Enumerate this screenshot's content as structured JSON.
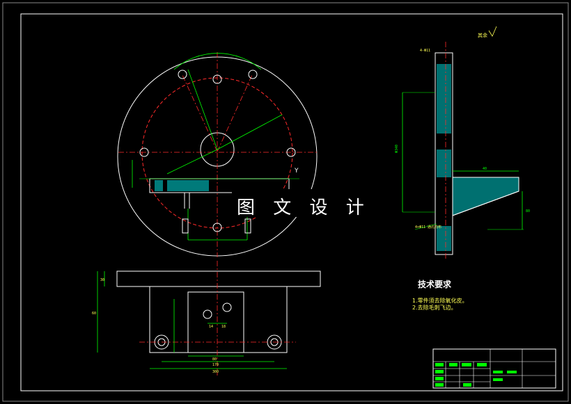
{
  "watermark": "图 文 设 计",
  "technical_requirements": {
    "title": "技术要求",
    "items": [
      "1.零件须去除氧化皮。",
      "2.去除毛刺飞边。"
    ]
  },
  "roughness_note": "其余",
  "dimensions": {
    "base_width": "300",
    "base_inner": "170",
    "base_mid": "80",
    "bore_spacing": "14",
    "bore_spacing2": "18",
    "plate_thk": "30",
    "base_height": "60",
    "side_main": "Φ340",
    "side_rib": "40",
    "side_web": "80",
    "note_holes": "4-Φ11",
    "note_holes2": "4×Φ11 通孔均布"
  },
  "colors": {
    "outline": "#ffffff",
    "dimension": "#00ff00",
    "centerline": "#ff2a2a",
    "hatch": "#00cccc",
    "text": "#ffff55",
    "background": "#000000"
  }
}
